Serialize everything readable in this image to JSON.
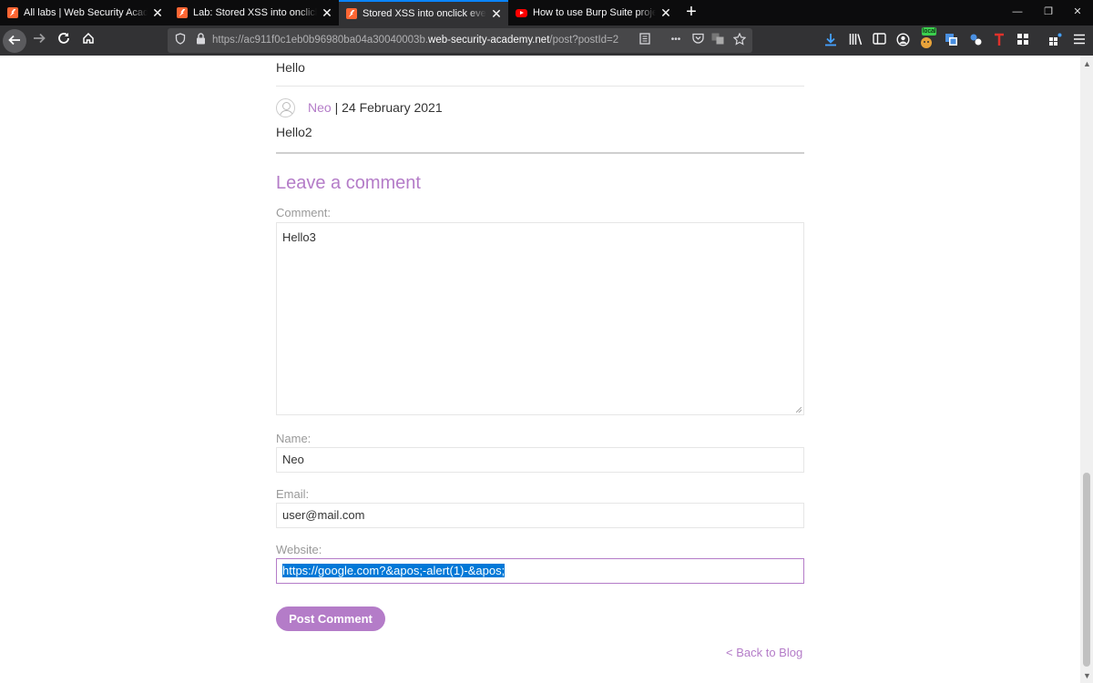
{
  "browser": {
    "tabs": [
      {
        "title": "All labs | Web Security Academy",
        "favicon": "portswigger-icon"
      },
      {
        "title": "Lab: Stored XSS into onclick event",
        "favicon": "portswigger-icon"
      },
      {
        "title": "Stored XSS into onclick event with",
        "favicon": "portswigger-icon"
      },
      {
        "title": "How to use Burp Suite projects",
        "favicon": "youtube-icon"
      }
    ],
    "active_tab": 2,
    "close_glyph": "✕",
    "new_tab_glyph": "+",
    "window_controls": {
      "minimize": "—",
      "restore": "❐",
      "close": "✕"
    },
    "url": {
      "prefix": "https://ac911f0c1eb0b96980ba04a30040003b.",
      "host": "web-security-academy.net",
      "path": "/post?postId=2"
    },
    "page_actions_glyph": "•••",
    "extension_badge": "local"
  },
  "comments": {
    "previous_text": "Hello",
    "second": {
      "author": "Neo",
      "separator": " | ",
      "date": "24 February 2021",
      "text": "Hello2"
    }
  },
  "form": {
    "heading": "Leave a comment",
    "comment_label": "Comment:",
    "comment_value": "Hello3",
    "name_label": "Name:",
    "name_value": "Neo",
    "email_label": "Email:",
    "email_value": "user@mail.com",
    "website_label": "Website:",
    "website_value": "https://google.com?&apos;-alert(1)-&apos;",
    "submit_label": "Post Comment"
  },
  "back_link": "< Back to Blog",
  "colors": {
    "accent": "#b47cc8",
    "tab_active_border": "#0a84ff",
    "selection": "#0078d7"
  }
}
